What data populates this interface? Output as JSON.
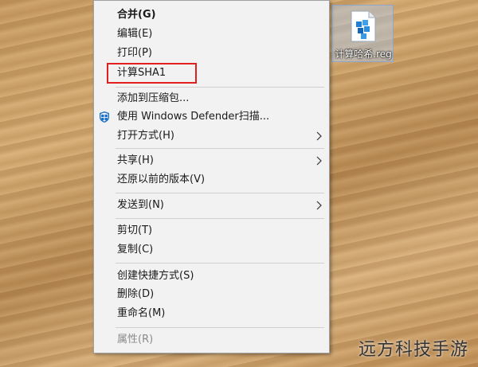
{
  "desktop_file": {
    "label": "计算哈希.reg",
    "icon": "registry-file-icon"
  },
  "context_menu": {
    "items": [
      {
        "label": "合并(G)",
        "bold": true
      },
      {
        "label": "编辑(E)"
      },
      {
        "label": "打印(P)"
      },
      {
        "label": "计算SHA1",
        "highlighted": true
      },
      {
        "label": "添加到压缩包..."
      },
      {
        "label": "使用 Windows Defender扫描...",
        "icon": "windows-defender-shield-icon"
      },
      {
        "label": "打开方式(H)",
        "submenu": true
      },
      {
        "label": "共享(H)",
        "submenu": true
      },
      {
        "label": "还原以前的版本(V)"
      },
      {
        "label": "发送到(N)",
        "submenu": true
      },
      {
        "label": "剪切(T)"
      },
      {
        "label": "复制(C)"
      },
      {
        "label": "创建快捷方式(S)"
      },
      {
        "label": "删除(D)"
      },
      {
        "label": "重命名(M)"
      },
      {
        "label": "属性(R)",
        "disabled": true
      }
    ],
    "highlight_color": "#e02020"
  },
  "watermark": "远方科技手游"
}
